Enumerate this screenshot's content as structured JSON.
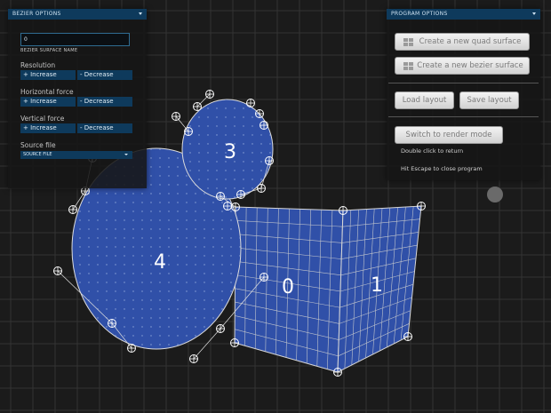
{
  "bezier_options": {
    "title": "BEZIER OPTIONS",
    "name_value": "0",
    "name_caption": "BEZIER SURFACE NAME",
    "resolution": {
      "label": "Resolution",
      "increase": "+ Increase",
      "decrease": "- Decrease"
    },
    "horizontal_force": {
      "label": "Horizontal force",
      "increase": "+ Increase",
      "decrease": "- Decrease"
    },
    "vertical_force": {
      "label": "Vertical force",
      "increase": "+ Increase",
      "decrease": "- Decrease"
    },
    "source_file": {
      "label": "Source file",
      "selected": "SOURCE FILE"
    }
  },
  "program_options": {
    "title": "PROGRAM OPTIONS",
    "create_quad": "Create a new quad surface",
    "create_bezier": "Create a new bezier surface",
    "load_layout": "Load layout",
    "save_layout": "Save layout",
    "render_mode": "Switch to render mode",
    "double_click_hint": "Double click to return",
    "escape_hint": "Hit Escape to close program"
  },
  "surfaces": [
    {
      "label": "0",
      "kind": "quad"
    },
    {
      "label": "1",
      "kind": "quad"
    },
    {
      "label": "3",
      "kind": "bezier"
    },
    {
      "label": "4",
      "kind": "bezier"
    }
  ],
  "colors": {
    "surface_fill": "#3050a8",
    "grid_line": "#c0c4cc",
    "handle": "#ffffff",
    "panel_header": "#0e3a5c"
  }
}
